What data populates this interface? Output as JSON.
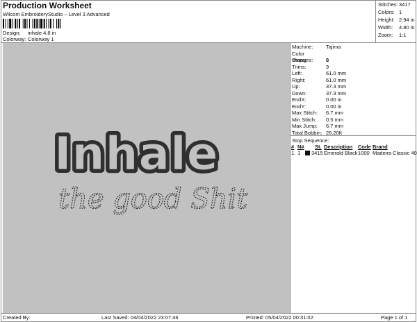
{
  "header": {
    "title": "Production Worksheet",
    "software": "Wilcom EmbroideryStudio – Level 3 Advanced",
    "design_label": "Design:",
    "design_value": "inhale 4,8 in",
    "colorway_label": "Colorway:",
    "colorway_value": "Colorway 1"
  },
  "stats": [
    {
      "label": "Stitches:",
      "value": "3417"
    },
    {
      "label": "Colors:",
      "value": "1"
    },
    {
      "label": "Height:",
      "value": "2.94 in"
    },
    {
      "label": "Width:",
      "value": "4.80 in"
    },
    {
      "label": "Zoom:",
      "value": "1:1"
    }
  ],
  "design": {
    "main_text": "Inhale",
    "sub_text": "the good Shit",
    "thread_color": "#2e302e"
  },
  "machine_info": [
    {
      "label": "Machine:",
      "value": "Tajima"
    },
    {
      "label": "Color changes:",
      "value": "0"
    },
    {
      "label": "Stops:",
      "value": "1"
    },
    {
      "label": "Trims:",
      "value": "9"
    },
    {
      "label": "Left:",
      "value": "61.0 mm"
    },
    {
      "label": "Right:",
      "value": "61.0 mm"
    },
    {
      "label": "Up:",
      "value": "37.3 mm"
    },
    {
      "label": "Down:",
      "value": "37.3 mm"
    },
    {
      "label": "EndX:",
      "value": "0.00 in"
    },
    {
      "label": "EndY:",
      "value": "0.00 in"
    },
    {
      "label": "Max Stitch:",
      "value": "6.7 mm"
    },
    {
      "label": "Min Stitch:",
      "value": "0.5 mm"
    },
    {
      "label": "Max Jump:",
      "value": "6.7 mm"
    },
    {
      "label": "Total Bobbin:",
      "value": "26.20ft"
    }
  ],
  "stop_sequence": {
    "title": "Stop Sequence:",
    "columns": [
      "#",
      "N#",
      "St.",
      "Description",
      "Code",
      "Brand"
    ],
    "rows": [
      {
        "num": "1.",
        "needle": "1",
        "stitches": "3415",
        "description": "Emerald Black",
        "code": "1000",
        "brand": "Madeira Classic 40",
        "color": "#111111"
      }
    ]
  },
  "footer": {
    "created_by": "Created By:",
    "last_saved": "Last Saved: 04/04/2022 23:07:46",
    "printed": "Printed: 05/04/2022 00:31:02",
    "page": "Page 1 of 1"
  }
}
